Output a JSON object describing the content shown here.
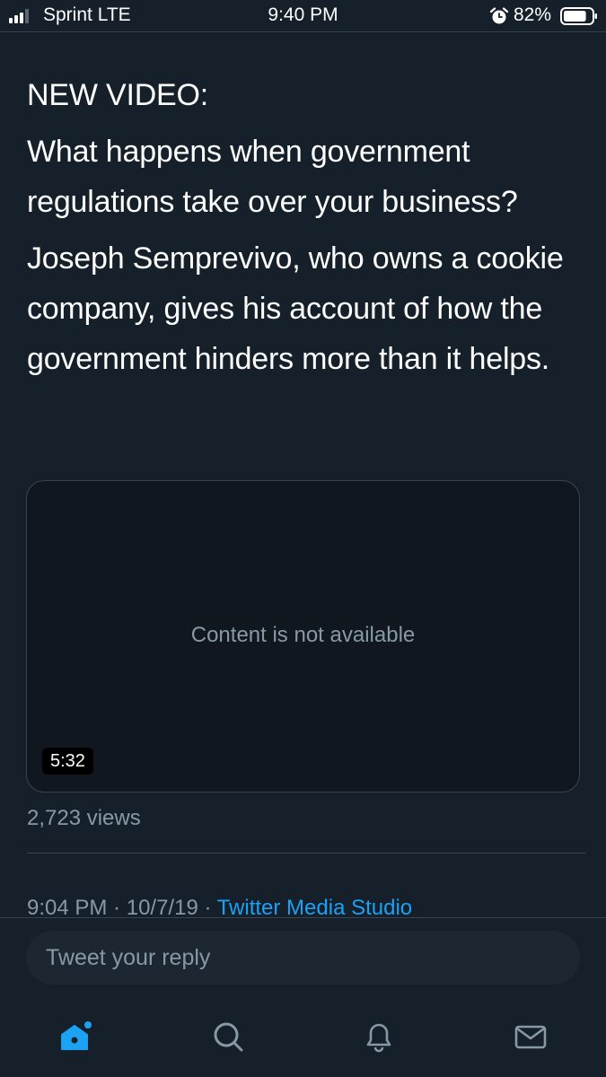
{
  "status_bar": {
    "carrier": "Sprint LTE",
    "time": "9:40 PM",
    "battery": "82%",
    "battery_level": 0.82,
    "signal_bars_filled": 3,
    "signal_bars_total": 4
  },
  "tweet": {
    "paragraphs": [
      "NEW VIDEO:",
      "What happens when government regulations take over your business?",
      "Joseph Semprevivo, who owns a cookie company, gives his account of how the government hinders more than it helps."
    ]
  },
  "video": {
    "message": "Content is not available",
    "duration": "5:32"
  },
  "views": "2,723 views",
  "meta": {
    "time": "9:04 PM",
    "separator": " · ",
    "date": "10/7/19",
    "source": "Twitter Media Studio"
  },
  "reply": {
    "placeholder": "Tweet your reply"
  },
  "tabs": [
    {
      "name": "home",
      "icon": "home-icon",
      "active": true
    },
    {
      "name": "search",
      "icon": "search-icon",
      "active": false
    },
    {
      "name": "notifications",
      "icon": "bell-icon",
      "active": false
    },
    {
      "name": "messages",
      "icon": "mail-icon",
      "active": false
    }
  ],
  "colors": {
    "background": "#15202b",
    "accent": "#1da1f2",
    "secondary_text": "#8899a6",
    "border": "#38444d"
  }
}
